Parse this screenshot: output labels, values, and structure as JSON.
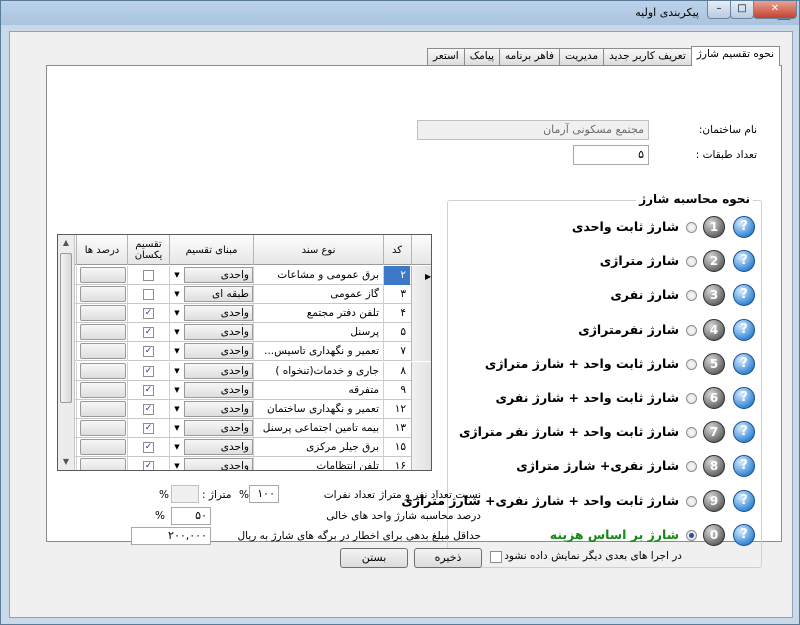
{
  "window": {
    "title": "پیکربندی اولیه",
    "min_label": "–",
    "max_label": "□",
    "close_label": "✕"
  },
  "tabs": [
    "نحوه تقسیم شارژ",
    "تعریف کاربر جدید",
    "مدیریت",
    "فاهر برنامه",
    "پیامک",
    "استعر"
  ],
  "building": {
    "name_label": "نام ساختمان:",
    "name_value": "مجتمع مسکونی آرمان",
    "floors_label": "تعداد طبقات :",
    "floors_value": "۵"
  },
  "calc": {
    "title": "نحوه محاسبه شارژ",
    "selected_index": 9,
    "options": [
      {
        "num": "1",
        "label": "شارژ ثابت واحدی"
      },
      {
        "num": "2",
        "label": "شارژ متراژی"
      },
      {
        "num": "3",
        "label": "شارژ نفری"
      },
      {
        "num": "4",
        "label": "شارژ نفرمتراژی"
      },
      {
        "num": "5",
        "label": "شارژ ثابت واحد + شارژ متراژی"
      },
      {
        "num": "6",
        "label": "شارژ ثابت واحد + شارژ نفری"
      },
      {
        "num": "7",
        "label": "شارژ ثابت واحد + شارژ نفر متراژی"
      },
      {
        "num": "8",
        "label": "شارژ نفری+ شارژ متراژی"
      },
      {
        "num": "9",
        "label": "شارژ ثابت واحد +  شارژ نفری+ شارژ متراژی"
      },
      {
        "num": "0",
        "label": "شارژ بر اساس هزینه"
      }
    ]
  },
  "grid": {
    "headers": {
      "code": "کد",
      "doc_type": "نوع سند",
      "basis": "مبنای تقسیم",
      "equal": "تقسیم یکسان",
      "percents": "درصد ها"
    },
    "rows": [
      {
        "code": "۲",
        "doc": "برق عمومی و مشاعات",
        "basis": "واحدی",
        "equal": false,
        "selected": true
      },
      {
        "code": "۳",
        "doc": "گاز عمومی",
        "basis": "طبقه ای",
        "equal": false,
        "selected": false
      },
      {
        "code": "۴",
        "doc": "تلفن دفتر مجتمع",
        "basis": "واحدی",
        "equal": true,
        "selected": false
      },
      {
        "code": "۵",
        "doc": "پرسنل",
        "basis": "واحدی",
        "equal": true,
        "selected": false
      },
      {
        "code": "۷",
        "doc": "تعمیر و نگهداری تاسیس...",
        "basis": "واحدی",
        "equal": true,
        "selected": false
      },
      {
        "code": "۸",
        "doc": "جاری و خدمات(تنخواه )",
        "basis": "واحدی",
        "equal": true,
        "selected": false
      },
      {
        "code": "۹",
        "doc": "متفرقه",
        "basis": "واحدی",
        "equal": true,
        "selected": false
      },
      {
        "code": "۱۲",
        "doc": "تعمیر و نگهداری  ساختمان",
        "basis": "واحدی",
        "equal": true,
        "selected": false
      },
      {
        "code": "۱۳",
        "doc": "بیمه تامین اجتماعی پرسنل",
        "basis": "واحدی",
        "equal": true,
        "selected": false
      },
      {
        "code": "۱۵",
        "doc": "برق جیلر مرکزی",
        "basis": "واحدی",
        "equal": true,
        "selected": false
      },
      {
        "code": "۱۶",
        "doc": "تلفن انتظامات",
        "basis": "واحدی",
        "equal": true,
        "selected": false
      }
    ]
  },
  "ratio": {
    "label": "نسبت تعداد نفر و متراژ",
    "people_label": "تعداد نفرات",
    "people_value": "۱۰۰",
    "pct1": "%",
    "meter_label": "متراژ :",
    "meter_value": "",
    "pct2": "%"
  },
  "vacancy": {
    "label": "درصد محاسبه شارژ واحد های خالی",
    "value": "۵۰",
    "pct": "%"
  },
  "min_debt": {
    "label": "حداقل مبلغ بدهی برای اخطار در برگه های شارژ به ریال",
    "value": "۲۰۰,۰۰۰"
  },
  "footer": {
    "no_show_label": "در اجرا های بعدی دیگر نمایش داده نشود",
    "save_label": "ذخیره",
    "close_label": "بستن"
  }
}
